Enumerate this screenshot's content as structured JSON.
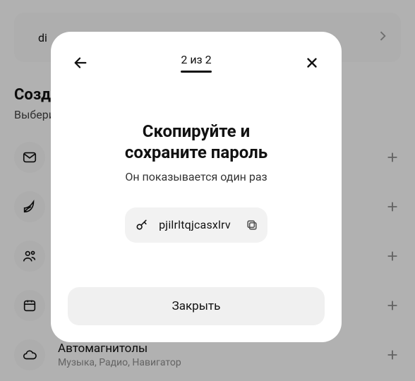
{
  "bg": {
    "top_item": {
      "text": "di"
    },
    "section_title": "Создайте пароль",
    "section_sub": "Выберите тип устройства",
    "items": [
      {
        "title": "",
        "sub": ""
      },
      {
        "title": "",
        "sub": ""
      },
      {
        "title": "",
        "sub": ""
      },
      {
        "title": "",
        "sub": ""
      },
      {
        "title": "Автомагнитолы",
        "sub": "Музыка, Радио, Навигатор"
      }
    ]
  },
  "modal": {
    "step": "2 из 2",
    "title_line1": "Скопируйте и",
    "title_line2": "сохраните пароль",
    "subtitle": "Он показывается один раз",
    "password": "pjilrltqjcasxlrv",
    "close_label": "Закрыть"
  }
}
